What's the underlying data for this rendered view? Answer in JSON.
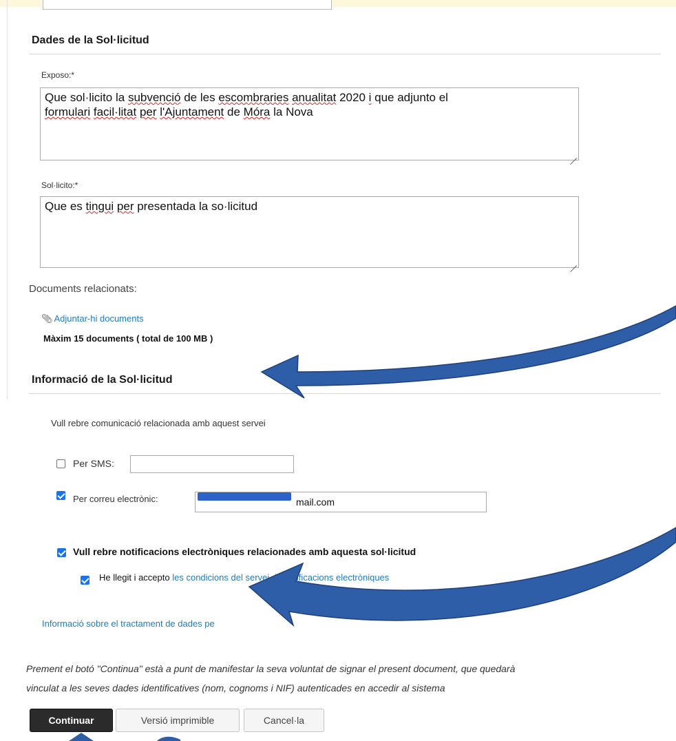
{
  "section_request": {
    "title": "Dades de la Sol·licitud",
    "exposo_label": "Exposo:*",
    "exposo_segments": [
      "Que sol·licito la ",
      "subvenció",
      " de les ",
      "escombraries",
      " ",
      "anualitat",
      " 2020 ",
      "i",
      " que adjunto el ",
      "formulari",
      " ",
      "facil·litat",
      " ",
      "per",
      " ",
      "l'Ajuntament",
      " de ",
      "Móra",
      " la Nova"
    ],
    "solicito_label": "Sol·licito:*",
    "solicito_segments": [
      "Que es ",
      "tingui",
      " ",
      "per",
      " presentada la so·licitud"
    ]
  },
  "documents": {
    "label": "Documents relacionats:",
    "attach_link": "Adjuntar-hi documents",
    "max_info": "Màxim 15 documents ( total de 100 MB )"
  },
  "section_info": {
    "title": "Informació de la Sol·licitud",
    "communication_text": "Vull rebre comunicació relacionada amb aquest servei",
    "sms_label": "Per SMS:",
    "sms_value": "",
    "sms_checked": false,
    "email_label": "Per correu electrònic:",
    "email_value": "mail.com",
    "email_checked": true,
    "notif_label": "Vull rebre notificacions electròniques relacionades amb aquesta sol·licitud",
    "notif_checked": true,
    "accept_prefix": "He llegit i accepto ",
    "accept_link": "les condicions del servei de notificacions electròniques",
    "accept_checked": true,
    "privacy_link": "Informació sobre el tractament de dades pe"
  },
  "footer": {
    "note_line1": "Prement el botó \"Continua\" està a punt de manifestar la seva voluntat de signar el present document, que quedarà",
    "note_line2": "vinculat a les seves dades identificatives (nom, cognoms i NIF) autenticades en accedir al sistema",
    "continue": "Continuar",
    "printable": "Versió imprimible",
    "cancel": "Cancel·la"
  },
  "colors": {
    "link": "#1f7bc1",
    "checkbox": "#1a73e8",
    "primary_button": "#2b2b2b",
    "annotation_arrow": "#2e5ea8",
    "top_strip": "#fdf8dc"
  },
  "icons": {
    "attach": "paperclip-icon"
  }
}
